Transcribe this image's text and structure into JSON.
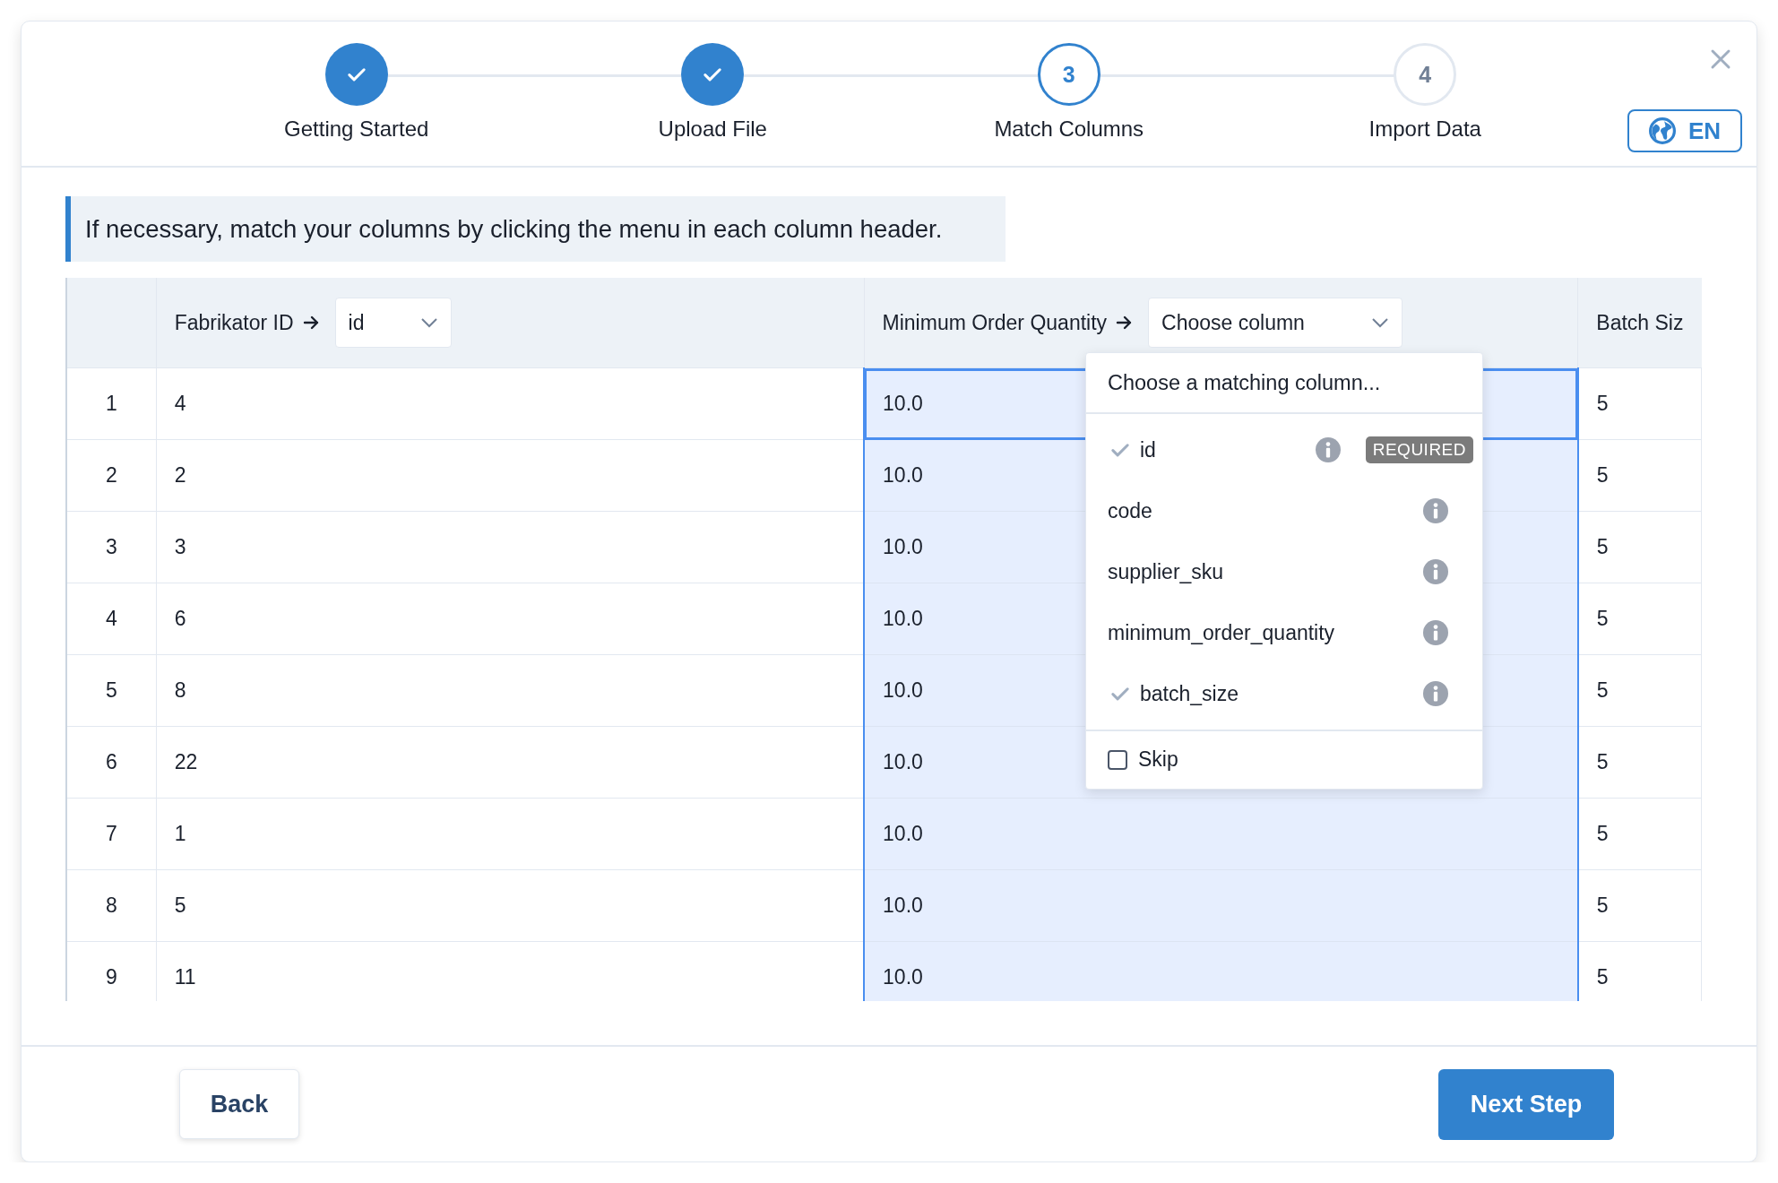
{
  "steps": [
    {
      "label": "Getting Started",
      "kind": "done"
    },
    {
      "label": "Upload File",
      "kind": "done"
    },
    {
      "label": "Match Columns",
      "number": "3",
      "kind": "current"
    },
    {
      "label": "Import Data",
      "number": "4",
      "kind": "todo"
    }
  ],
  "language_button": "EN",
  "instruction": "If necessary, match your columns by clicking the menu in each column header.",
  "table": {
    "columns": [
      {
        "source": "Fabrikator ID",
        "match": "id",
        "selected": false
      },
      {
        "source": "Minimum Order Quantity",
        "placeholder": "Choose column",
        "selected": true
      },
      {
        "source": "Batch Siz",
        "selected": false
      }
    ],
    "rows": [
      {
        "index": "1",
        "cells": [
          "4",
          "10.0",
          "5"
        ],
        "focused": true
      },
      {
        "index": "2",
        "cells": [
          "2",
          "10.0",
          "5"
        ],
        "focused": false
      },
      {
        "index": "3",
        "cells": [
          "3",
          "10.0",
          "5"
        ],
        "focused": false
      },
      {
        "index": "4",
        "cells": [
          "6",
          "10.0",
          "5"
        ],
        "focused": false
      },
      {
        "index": "5",
        "cells": [
          "8",
          "10.0",
          "5"
        ],
        "focused": false
      },
      {
        "index": "6",
        "cells": [
          "22",
          "10.0",
          "5"
        ],
        "focused": false
      },
      {
        "index": "7",
        "cells": [
          "1",
          "10.0",
          "5"
        ],
        "focused": false
      },
      {
        "index": "8",
        "cells": [
          "5",
          "10.0",
          "5"
        ],
        "focused": false
      },
      {
        "index": "9",
        "cells": [
          "11",
          "10.0",
          "5"
        ],
        "focused": false
      }
    ]
  },
  "column_menu": {
    "heading": "Choose a matching column...",
    "options": [
      {
        "label": "id",
        "checked": true,
        "badge": "REQUIRED"
      },
      {
        "label": "code",
        "checked": false
      },
      {
        "label": "supplier_sku",
        "checked": false
      },
      {
        "label": "minimum_order_quantity",
        "checked": false
      },
      {
        "label": "batch_size",
        "checked": true
      }
    ],
    "skip": {
      "label": "Skip",
      "checked": false
    }
  },
  "footer": {
    "back": "Back",
    "next": "Next Step"
  }
}
